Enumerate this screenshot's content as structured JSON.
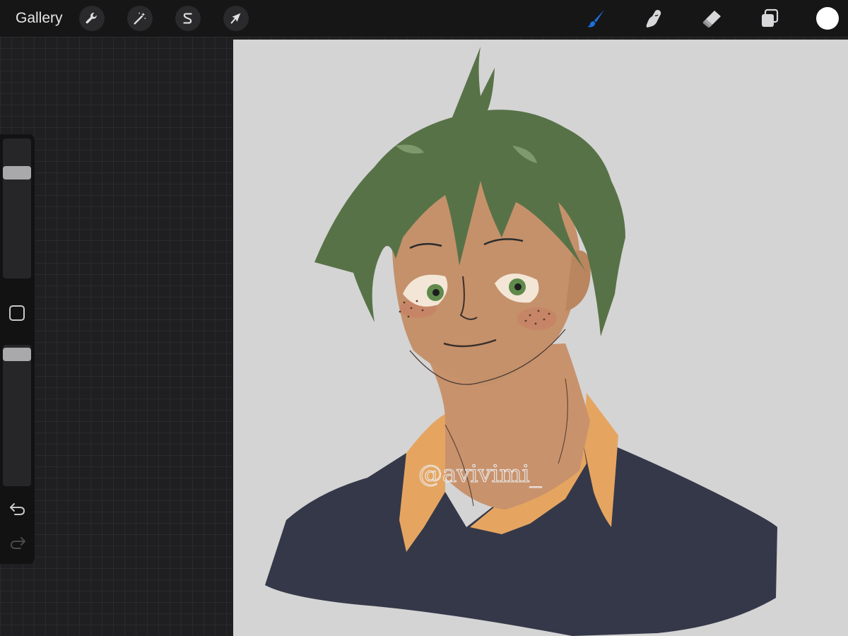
{
  "toolbar": {
    "gallery_label": "Gallery",
    "left_tools": [
      {
        "name": "actions",
        "icon": "wrench-icon"
      },
      {
        "name": "adjustments",
        "icon": "magic-wand-icon"
      },
      {
        "name": "selection",
        "icon": "selection-s-icon"
      },
      {
        "name": "transform",
        "icon": "arrow-cursor-icon"
      }
    ],
    "right_tools": [
      {
        "name": "brush",
        "icon": "brush-icon",
        "active": true
      },
      {
        "name": "smudge",
        "icon": "smudge-finger-icon",
        "active": false
      },
      {
        "name": "eraser",
        "icon": "eraser-icon",
        "active": false
      },
      {
        "name": "layers",
        "icon": "layers-icon",
        "active": false
      }
    ],
    "current_color": "#ffffff",
    "active_tool_color": "#1e6fe0"
  },
  "sidebar": {
    "brush_size_level": 0.9,
    "brush_opacity_level": 0.97,
    "modify_icon": "square-modify-icon",
    "undo_icon": "undo-arrow-icon",
    "redo_icon": "redo-arrow-icon"
  },
  "canvas": {
    "background_color": "#d4d4d4",
    "watermark": "@avivimi_",
    "artwork": "digital sketch of a smiling young man with green hair, freckles, orange collared shirt and navy sweater"
  }
}
